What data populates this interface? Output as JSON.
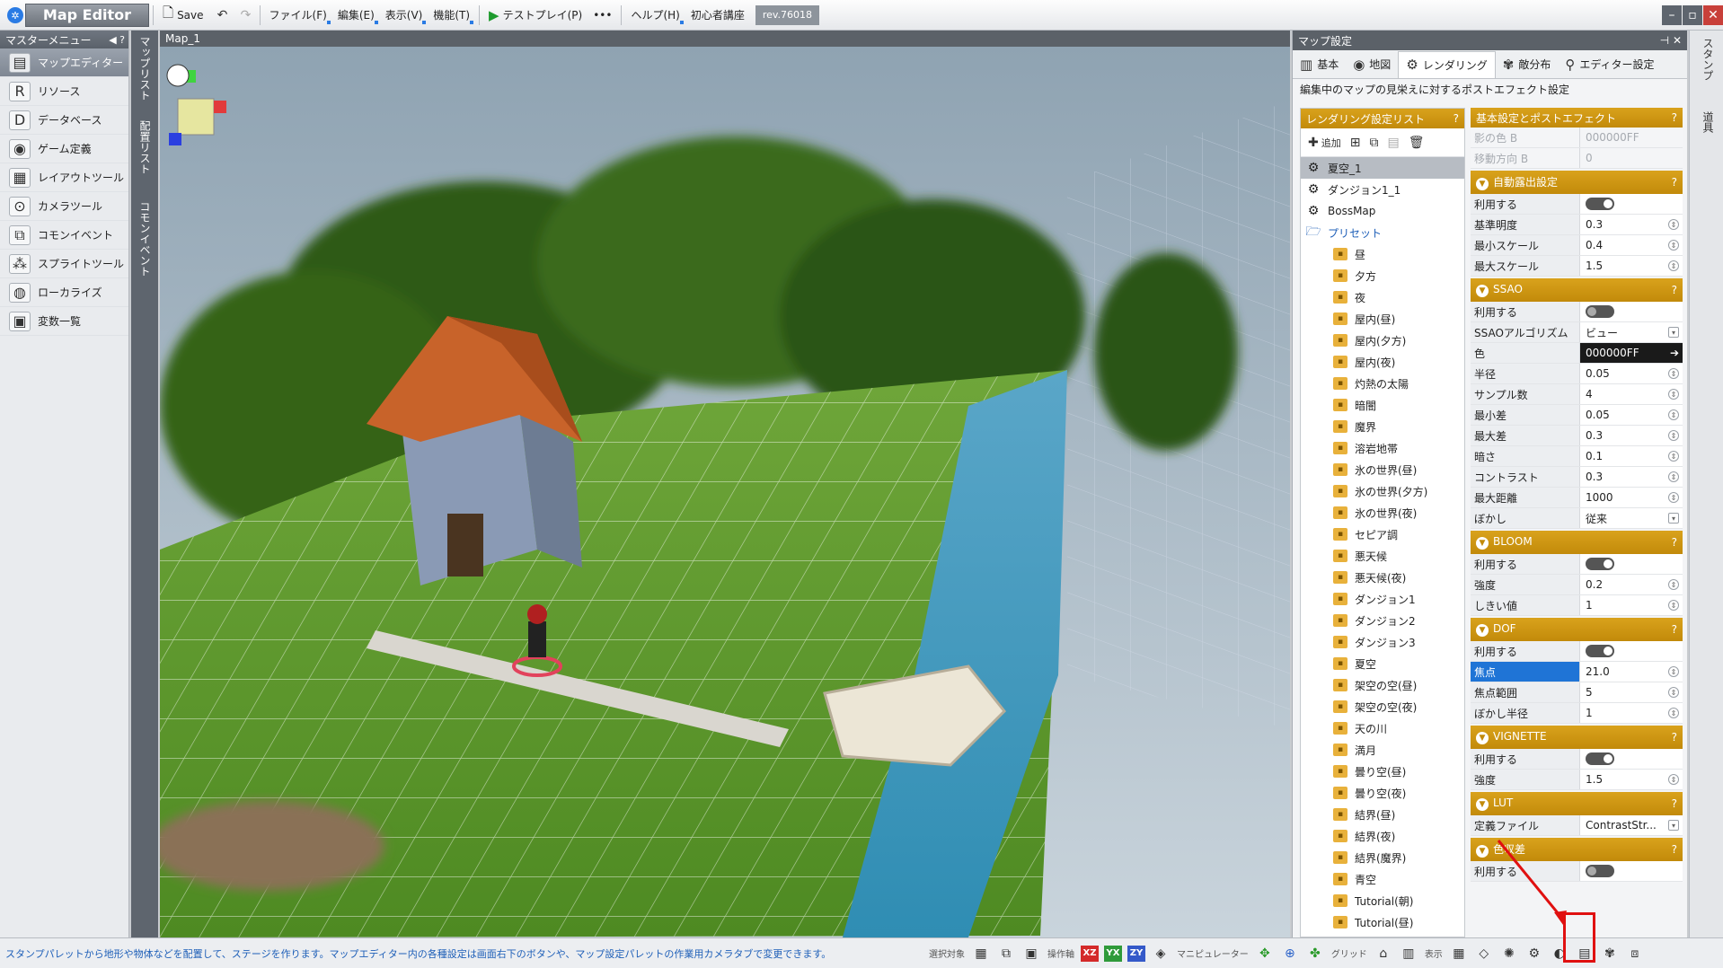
{
  "toolbar": {
    "logo": "Map Editor",
    "save": "Save",
    "menus": [
      "ファイル(F)",
      "編集(E)",
      "表示(V)",
      "機能(T)"
    ],
    "testplay": "テストプレイ(P)",
    "more": "•••",
    "help": "ヘルプ(H)",
    "tutorial": "初心者講座",
    "rev": "rev.76018"
  },
  "left_menu": {
    "title": "マスターメニュー",
    "items": [
      {
        "label": "マップエディター",
        "icon": "map-editor-icon"
      },
      {
        "label": "リソース",
        "icon": "resource-icon"
      },
      {
        "label": "データベース",
        "icon": "database-icon"
      },
      {
        "label": "ゲーム定義",
        "icon": "game-definition-icon"
      },
      {
        "label": "レイアウトツール",
        "icon": "layout-tool-icon"
      },
      {
        "label": "カメラツール",
        "icon": "camera-tool-icon"
      },
      {
        "label": "コモンイベント",
        "icon": "common-event-icon"
      },
      {
        "label": "スプライトツール",
        "icon": "sprite-tool-icon"
      },
      {
        "label": "ローカライズ",
        "icon": "localize-icon"
      },
      {
        "label": "変数一覧",
        "icon": "variables-icon"
      }
    ]
  },
  "vtabs": [
    "マップリスト",
    "配置リスト",
    "コモンイベント"
  ],
  "viewport": {
    "title": "Map_1"
  },
  "map_settings": {
    "title": "マップ設定",
    "tabs": [
      "基本",
      "地図",
      "レンダリング",
      "敵分布",
      "エディター設定"
    ],
    "desc": "編集中のマップの見栄えに対するポストエフェクト設定",
    "list_header": "レンダリング設定リスト",
    "add": "追加",
    "list_items": [
      "夏空_1",
      "ダンジョン1_1",
      "BossMap"
    ],
    "preset_label": "プリセット",
    "presets": [
      "昼",
      "夕方",
      "夜",
      "屋内(昼)",
      "屋内(夕方)",
      "屋内(夜)",
      "灼熱の太陽",
      "暗闇",
      "魔界",
      "溶岩地帯",
      "氷の世界(昼)",
      "氷の世界(夕方)",
      "氷の世界(夜)",
      "セピア調",
      "悪天候",
      "悪天候(夜)",
      "ダンジョン1",
      "ダンジョン2",
      "ダンジョン3",
      "夏空",
      "架空の空(昼)",
      "架空の空(夜)",
      "天の川",
      "満月",
      "曇り空(昼)",
      "曇り空(夜)",
      "結界(昼)",
      "結界(夜)",
      "結界(魔界)",
      "青空",
      "Tutorial(朝)",
      "Tutorial(昼)"
    ],
    "props_header": "基本設定とポストエフェクト",
    "top_rows": [
      {
        "k": "影の色 B",
        "v": "000000FF"
      },
      {
        "k": "移動方向 B",
        "v": "0"
      }
    ],
    "groups": [
      {
        "name": "自動露出設定",
        "rows": [
          {
            "k": "利用する",
            "t": "on"
          },
          {
            "k": "基準明度",
            "v": "0.3"
          },
          {
            "k": "最小スケール",
            "v": "0.4"
          },
          {
            "k": "最大スケール",
            "v": "1.5"
          }
        ]
      },
      {
        "name": "SSAO",
        "rows": [
          {
            "k": "利用する",
            "t": "off"
          },
          {
            "k": "SSAOアルゴリズム",
            "v": "ビュー",
            "d": "1"
          },
          {
            "k": "色",
            "v": "000000FF",
            "c": "1"
          },
          {
            "k": "半径",
            "v": "0.05"
          },
          {
            "k": "サンプル数",
            "v": "4"
          },
          {
            "k": "最小差",
            "v": "0.05"
          },
          {
            "k": "最大差",
            "v": "0.3"
          },
          {
            "k": "暗さ",
            "v": "0.1"
          },
          {
            "k": "コントラスト",
            "v": "0.3"
          },
          {
            "k": "最大距離",
            "v": "1000"
          },
          {
            "k": "ぼかし",
            "v": "従来",
            "d": "1"
          }
        ]
      },
      {
        "name": "BLOOM",
        "rows": [
          {
            "k": "利用する",
            "t": "on"
          },
          {
            "k": "強度",
            "v": "0.2"
          },
          {
            "k": "しきい値",
            "v": "1"
          }
        ]
      },
      {
        "name": "DOF",
        "rows": [
          {
            "k": "利用する",
            "t": "on"
          },
          {
            "k": "焦点",
            "v": "21.0",
            "h": "1"
          },
          {
            "k": "焦点範囲",
            "v": "5"
          },
          {
            "k": "ぼかし半径",
            "v": "1"
          }
        ]
      },
      {
        "name": "VIGNETTE",
        "rows": [
          {
            "k": "利用する",
            "t": "on"
          },
          {
            "k": "強度",
            "v": "1.5"
          }
        ]
      },
      {
        "name": "LUT",
        "rows": [
          {
            "k": "定義ファイル",
            "v": "ContrastStr...",
            "d": "1"
          }
        ]
      },
      {
        "name": "色収差",
        "rows": [
          {
            "k": "利用する",
            "t": "off"
          }
        ]
      }
    ]
  },
  "right_strip": [
    "スタンプ",
    "道具"
  ],
  "status": {
    "text": "スタンプパレットから地形や物体などを配置して、ステージを作ります。マップエディター内の各種設定は画面右下のボタンや、マップ設定パレットの作業用カメラタブで変更できます。",
    "select": "選択対象",
    "axis": "操作軸",
    "manip": "マニピュレーター",
    "grid": "グリッド",
    "display": "表示",
    "xz": "XZ",
    "yx": "YX",
    "zy": "ZY"
  }
}
